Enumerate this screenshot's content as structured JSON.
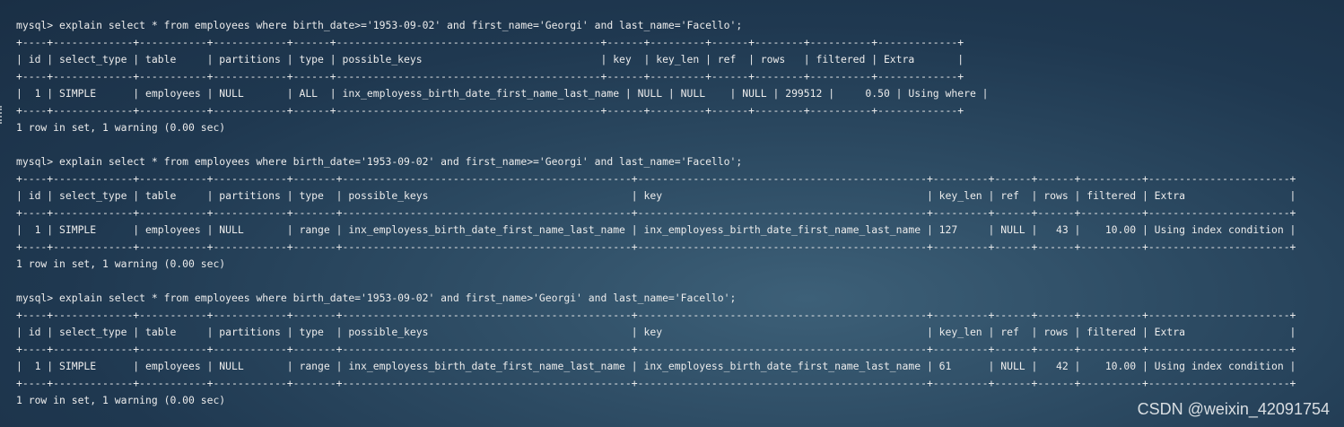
{
  "terminal": {
    "lines": [
      "mysql> explain select * from employees where birth_date>='1953-09-02' and first_name='Georgi' and last_name='Facello';",
      "+----+-------------+-----------+------------+------+-------------------------------------------+------+---------+------+--------+----------+-------------+",
      "| id | select_type | table     | partitions | type | possible_keys                             | key  | key_len | ref  | rows   | filtered | Extra       |",
      "+----+-------------+-----------+------------+------+-------------------------------------------+------+---------+------+--------+----------+-------------+",
      "|  1 | SIMPLE      | employees | NULL       | ALL  | inx_employess_birth_date_first_name_last_name | NULL | NULL    | NULL | 299512 |     0.50 | Using where |",
      "+----+-------------+-----------+------------+------+-------------------------------------------+------+---------+------+--------+----------+-------------+",
      "1 row in set, 1 warning (0.00 sec)",
      "",
      "mysql> explain select * from employees where birth_date='1953-09-02' and first_name>='Georgi' and last_name='Facello';",
      "+----+-------------+-----------+------------+-------+-----------------------------------------------+-----------------------------------------------+---------+------+------+----------+-----------------------+",
      "| id | select_type | table     | partitions | type  | possible_keys                                 | key                                           | key_len | ref  | rows | filtered | Extra                 |",
      "+----+-------------+-----------+------------+-------+-----------------------------------------------+-----------------------------------------------+---------+------+------+----------+-----------------------+",
      "|  1 | SIMPLE      | employees | NULL       | range | inx_employess_birth_date_first_name_last_name | inx_employess_birth_date_first_name_last_name | 127     | NULL |   43 |    10.00 | Using index condition |",
      "+----+-------------+-----------+------------+-------+-----------------------------------------------+-----------------------------------------------+---------+------+------+----------+-----------------------+",
      "1 row in set, 1 warning (0.00 sec)",
      "",
      "mysql> explain select * from employees where birth_date='1953-09-02' and first_name>'Georgi' and last_name='Facello';",
      "+----+-------------+-----------+------------+-------+-----------------------------------------------+-----------------------------------------------+---------+------+------+----------+-----------------------+",
      "| id | select_type | table     | partitions | type  | possible_keys                                 | key                                           | key_len | ref  | rows | filtered | Extra                 |",
      "+----+-------------+-----------+------------+-------+-----------------------------------------------+-----------------------------------------------+---------+------+------+----------+-----------------------+",
      "|  1 | SIMPLE      | employees | NULL       | range | inx_employess_birth_date_first_name_last_name | inx_employess_birth_date_first_name_last_name | 61      | NULL |   42 |    10.00 | Using index condition |",
      "+----+-------------+-----------+------------+-------+-----------------------------------------------+-----------------------------------------------+---------+------+------+----------+-----------------------+",
      "1 row in set, 1 warning (0.00 sec)"
    ]
  },
  "watermark": "CSDN @weixin_42091754"
}
